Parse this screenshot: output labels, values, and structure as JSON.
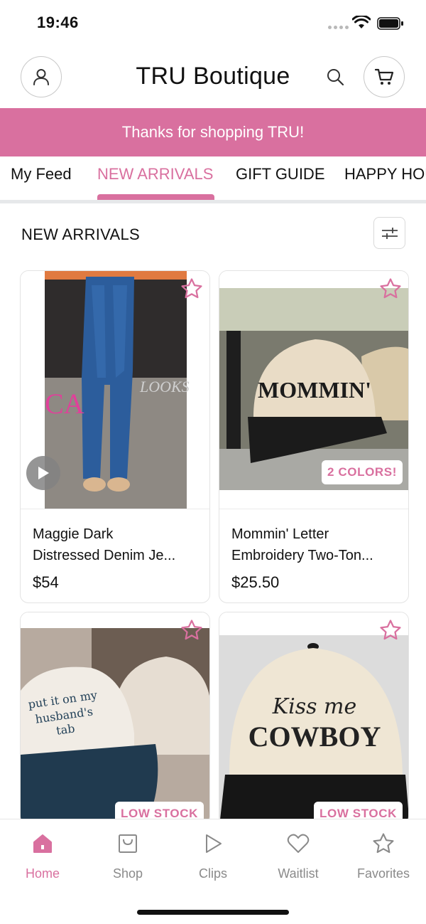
{
  "status": {
    "time": "19:46"
  },
  "header": {
    "title": "TRU Boutique"
  },
  "banner": {
    "text": "Thanks for shopping TRU!"
  },
  "tabs": [
    {
      "label": "My Feed"
    },
    {
      "label": "NEW ARRIVALS",
      "active": true
    },
    {
      "label": "GIFT GUIDE"
    },
    {
      "label": "HAPPY HOUR"
    }
  ],
  "section": {
    "title": "NEW ARRIVALS"
  },
  "products": [
    {
      "name_line1": "Maggie Dark",
      "name_line2": "Distressed Denim Je...",
      "price": "$54",
      "badge": "",
      "has_video": true
    },
    {
      "name_line1": "Mommin' Letter",
      "name_line2": "Embroidery Two-Ton...",
      "price": "$25.50",
      "badge": "2 COLORS!",
      "image_text": "MOMMIN'"
    },
    {
      "badge": "LOW STOCK",
      "image_text_1": "put it on my",
      "image_text_2": "husband's",
      "image_text_3": "tab"
    },
    {
      "badge": "LOW STOCK",
      "image_text_1": "Kiss me",
      "image_text_2": "COWBOY"
    }
  ],
  "bottom_nav": [
    {
      "label": "Home",
      "icon": "home-icon",
      "active": true
    },
    {
      "label": "Shop",
      "icon": "shop-bag-icon"
    },
    {
      "label": "Clips",
      "icon": "play-icon"
    },
    {
      "label": "Waitlist",
      "icon": "heart-icon"
    },
    {
      "label": "Favorites",
      "icon": "star-icon"
    }
  ],
  "colors": {
    "accent": "#d9709f",
    "muted": "#8a8a8a"
  }
}
